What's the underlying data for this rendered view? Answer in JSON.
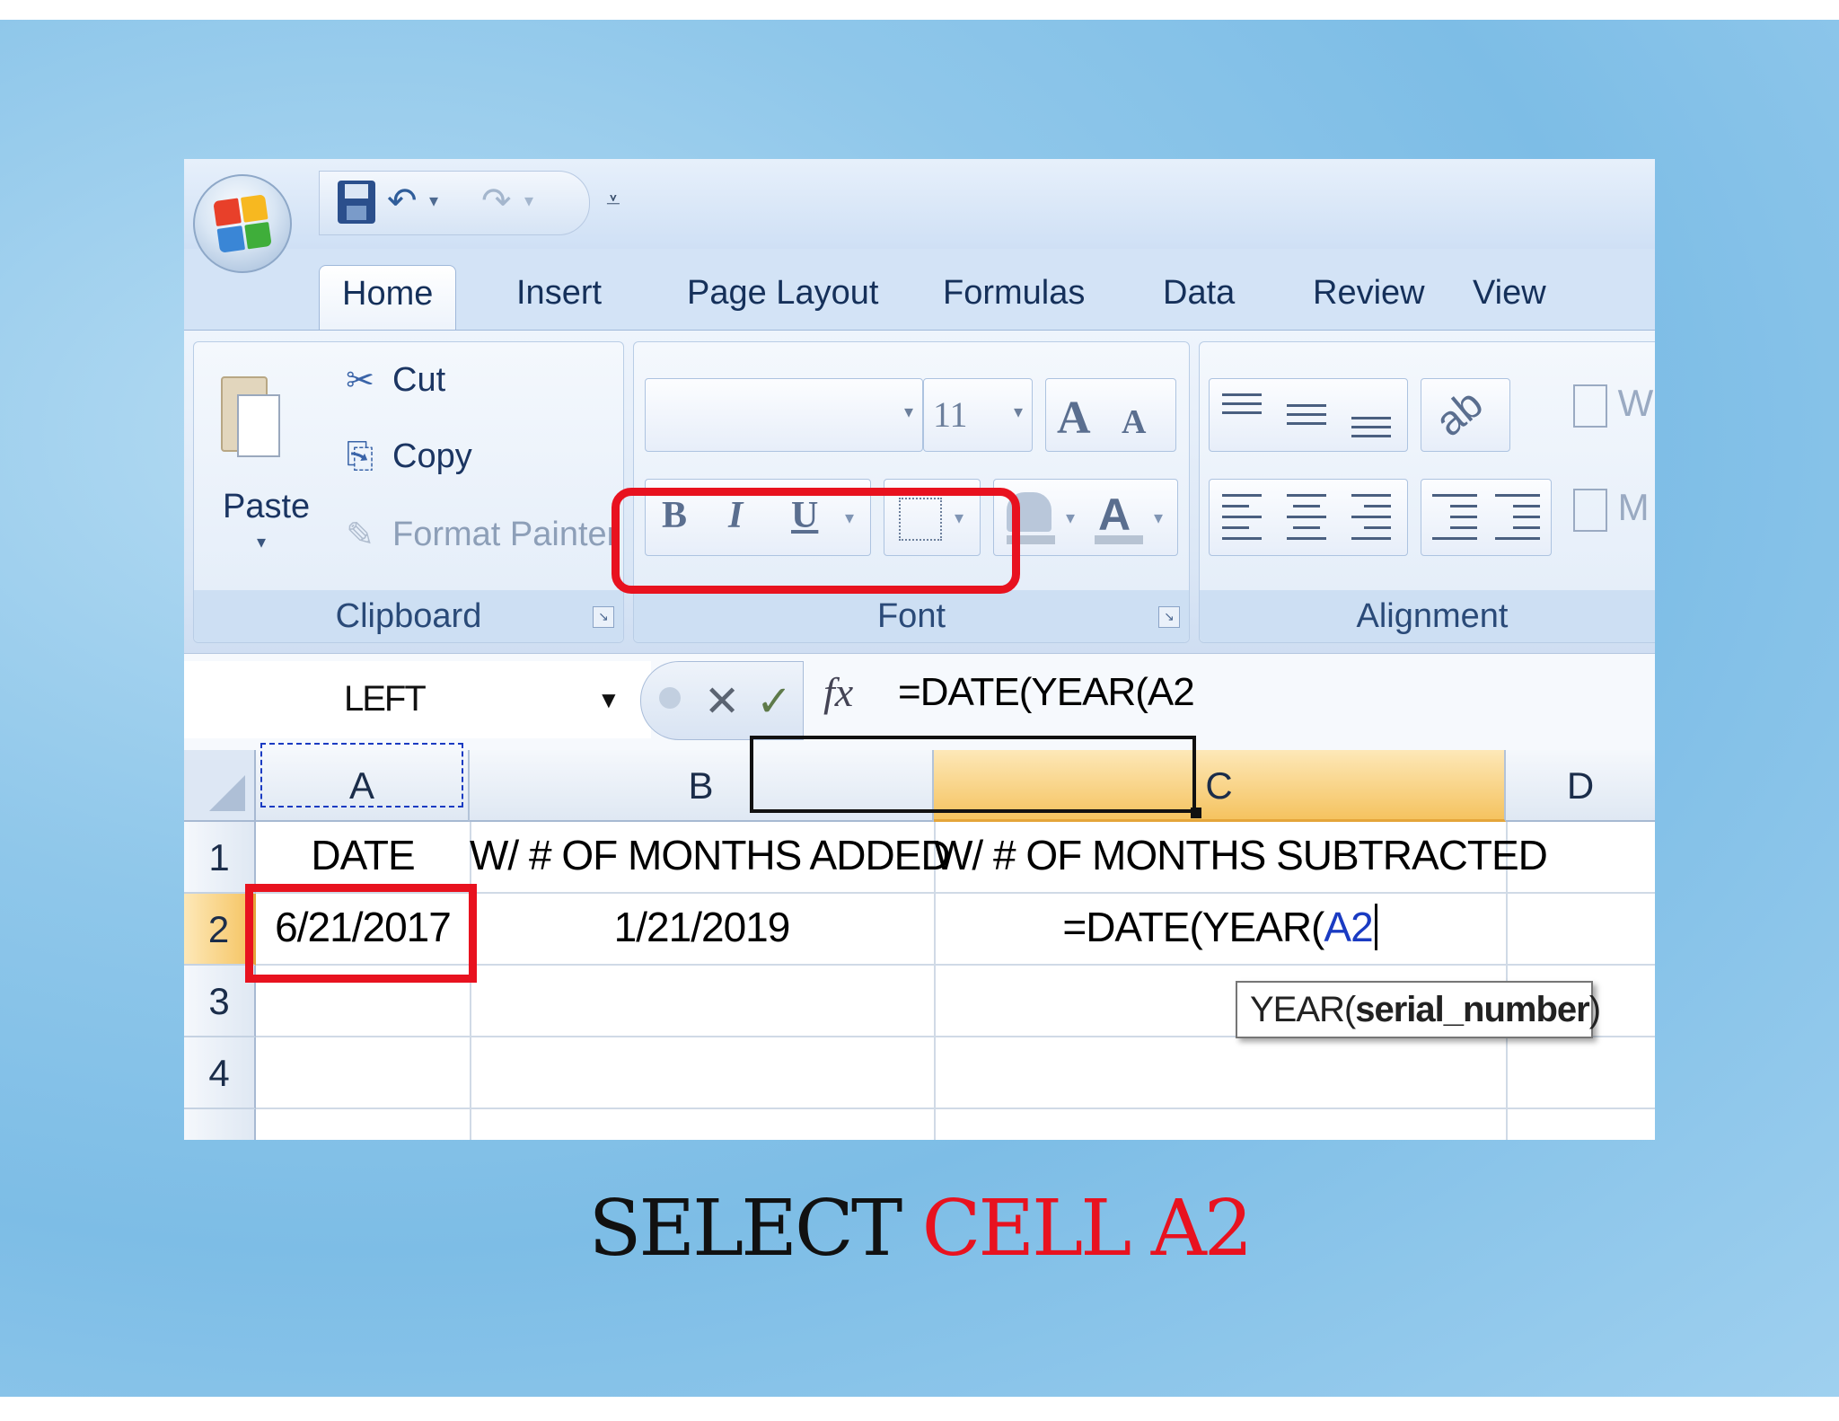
{
  "quick_access": {
    "save_icon": "save-icon",
    "undo_icon": "undo-icon",
    "redo_icon": "redo-icon",
    "customize_icon": "customize-qat-icon",
    "undo_glyph": "↶",
    "redo_glyph": "↷",
    "dropdown_glyph": "▾",
    "customize_glyph": "⩡"
  },
  "tabs": [
    {
      "label": "Home",
      "active": true
    },
    {
      "label": "Insert"
    },
    {
      "label": "Page Layout"
    },
    {
      "label": "Formulas"
    },
    {
      "label": "Data"
    },
    {
      "label": "Review"
    },
    {
      "label": "View"
    }
  ],
  "ribbon": {
    "clipboard": {
      "label": "Clipboard",
      "paste": "Paste",
      "cut": "Cut",
      "copy": "Copy",
      "format_painter": "Format Painter",
      "cut_glyph": "✂",
      "copy_glyph": "⎘",
      "painter_glyph": "✎"
    },
    "font": {
      "label": "Font",
      "font_name": "",
      "font_size": "11",
      "grow": "A",
      "shrink": "A",
      "bold": "B",
      "italic": "I",
      "underline": "U",
      "font_color": "A"
    },
    "alignment": {
      "label": "Alignment",
      "wrap_partial": "W",
      "merge_partial": "M"
    }
  },
  "formula_bar": {
    "name_box": "LEFT",
    "cancel_glyph": "✕",
    "enter_glyph": "✓",
    "fx": "fx",
    "formula": "=DATE(YEAR(A2"
  },
  "sheet": {
    "columns": [
      "A",
      "B",
      "C",
      "D"
    ],
    "rows": [
      "1",
      "2",
      "3",
      "4"
    ],
    "cells": {
      "A1": "DATE",
      "B1": "W/ # OF MONTHS ADDED",
      "C1": "W/ # OF MONTHS SUBTRACTED",
      "A2": "6/21/2017",
      "B2": "1/21/2019",
      "C2_prefix": "=DATE(YEAR(",
      "C2_ref": "A2"
    },
    "tooltip": {
      "func": "YEAR(",
      "arg": "serial_number",
      "close": ")"
    }
  },
  "caption": {
    "part1": "SELECT",
    "part2": "CELL A2"
  },
  "colors": {
    "highlight": "#e8121f",
    "selected_header": "#f5c360",
    "reference": "#1a3bc2",
    "paren_green": "#2a9a3a"
  }
}
